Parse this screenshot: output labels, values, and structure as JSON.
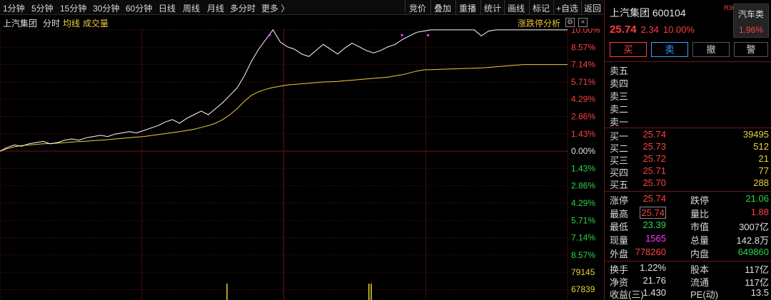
{
  "toolbar": {
    "periods": [
      "1分钟",
      "5分钟",
      "15分钟",
      "30分钟",
      "60分钟",
      "日线",
      "周线",
      "月线",
      "多分时",
      "更多 〉"
    ],
    "actions": [
      "竞价",
      "叠加",
      "重播",
      "统计",
      "画线",
      "标记",
      "+自选",
      "返回"
    ]
  },
  "chart_header": {
    "name": "上汽集团",
    "mode": "分时",
    "avg_label": "均线",
    "vol_label": "成交量",
    "limit_btn": "涨跌停分析",
    "gear": "⚙",
    "close": "×"
  },
  "chart_data": {
    "type": "line",
    "price_axis": {
      "left": [
        "",
        "",
        "",
        "",
        "",
        "",
        "",
        "",
        "",
        "",
        "",
        "",
        "",
        "",
        ""
      ],
      "right_labels": [
        "10.00%",
        "8.57%",
        "7.14%",
        "5.71%",
        "4.29%",
        "2.86%",
        "1.43%",
        "0.00%",
        "1.43%",
        "2.86%",
        "4.29%",
        "5.71%",
        "7.14%",
        "8.57%"
      ],
      "right_colors": [
        "red",
        "red",
        "red",
        "red",
        "red",
        "red",
        "red",
        "white",
        "green",
        "green",
        "green",
        "green",
        "green",
        "green"
      ],
      "ylim_pct": [
        -10,
        10
      ]
    },
    "volume_axis": {
      "labels": [
        "79145",
        "67839"
      ]
    },
    "x_minutes": 240,
    "price_pct": [
      0,
      0.3,
      0.5,
      0.4,
      0.6,
      0.7,
      0.8,
      0.6,
      0.7,
      0.9,
      1.0,
      0.9,
      1.1,
      1.2,
      1.3,
      1.2,
      1.4,
      1.5,
      1.6,
      1.5,
      1.7,
      1.9,
      2.1,
      2.4,
      2.6,
      2.3,
      2.7,
      3.0,
      3.3,
      3.0,
      3.5,
      4.0,
      4.6,
      5.2,
      6.2,
      7.4,
      8.4,
      9.2,
      10.0,
      9.0,
      8.6,
      8.4,
      8.0,
      7.8,
      8.3,
      8.8,
      8.4,
      8.0,
      8.5,
      8.9,
      8.6,
      8.3,
      8.1,
      8.3,
      8.6,
      8.8,
      9.2,
      9.5,
      9.8,
      9.9,
      10.0,
      10.0,
      10.0,
      10.0,
      10.0,
      10.0,
      10.0,
      9.5,
      9.9,
      10.0,
      10.0,
      10.0,
      10.0,
      10.0,
      10.0,
      10.0,
      10.0,
      10.0,
      10.0,
      10.0
    ],
    "avg_pct": [
      0,
      0.2,
      0.35,
      0.45,
      0.5,
      0.55,
      0.6,
      0.62,
      0.65,
      0.7,
      0.75,
      0.78,
      0.82,
      0.86,
      0.9,
      0.94,
      1.0,
      1.05,
      1.1,
      1.15,
      1.2,
      1.28,
      1.36,
      1.44,
      1.52,
      1.6,
      1.7,
      1.8,
      1.95,
      2.1,
      2.3,
      2.6,
      3.0,
      3.5,
      4.1,
      4.6,
      4.9,
      5.1,
      5.25,
      5.35,
      5.45,
      5.5,
      5.55,
      5.6,
      5.65,
      5.7,
      5.72,
      5.75,
      5.8,
      5.85,
      5.9,
      5.95,
      6.0,
      6.05,
      6.1,
      6.2,
      6.3,
      6.45,
      6.6,
      6.7,
      6.72,
      6.74,
      6.76,
      6.78,
      6.8,
      6.82,
      6.84,
      6.86,
      6.9,
      6.95,
      7.0,
      7.05,
      7.1,
      7.14,
      7.14,
      7.14,
      7.14,
      7.14,
      7.14,
      7.14
    ],
    "volume": [
      0.3,
      0,
      0,
      0,
      0,
      0,
      0,
      0,
      0,
      0,
      0,
      0,
      0,
      0,
      0,
      0,
      0,
      0,
      0,
      0,
      0,
      0,
      0,
      0,
      0,
      0,
      0,
      0,
      0,
      0,
      0,
      0,
      0,
      0,
      0,
      0,
      0,
      0,
      0,
      0,
      0,
      0,
      0,
      0,
      0,
      0,
      0,
      0,
      0,
      0,
      0,
      0,
      0,
      0,
      0,
      0,
      0,
      0,
      0,
      0,
      0,
      0,
      0,
      0,
      0,
      0,
      0,
      0,
      0,
      0,
      0,
      0,
      0,
      0,
      0,
      0,
      0,
      0,
      0,
      0
    ],
    "volume_spikes_minute": [
      96,
      156,
      157
    ],
    "markers_minute": [
      114,
      170,
      181
    ],
    "colors": {
      "price": "#ffffff",
      "avg": "#e8d23c",
      "grid": "#5a0f0f",
      "volume": "#e8d23c",
      "marker": "#ff3cff"
    }
  },
  "panel": {
    "title": "上汽集团 600104",
    "tag": "R300",
    "sector_name": "汽车类",
    "sector_pct": "1.96%",
    "price": "25.74",
    "change": "2.34",
    "change_pct": "10.00%",
    "buttons": {
      "buy": "买",
      "sell": "卖",
      "cancel": "撤",
      "warn": "警"
    },
    "asks": [
      {
        "label": "卖五",
        "price": "",
        "vol": ""
      },
      {
        "label": "卖四",
        "price": "",
        "vol": ""
      },
      {
        "label": "卖三",
        "price": "",
        "vol": ""
      },
      {
        "label": "卖二",
        "price": "",
        "vol": ""
      },
      {
        "label": "卖一",
        "price": "",
        "vol": ""
      }
    ],
    "bids": [
      {
        "label": "买一",
        "price": "25.74",
        "vol": "39495"
      },
      {
        "label": "买二",
        "price": "25.73",
        "vol": "512"
      },
      {
        "label": "买三",
        "price": "25.72",
        "vol": "21"
      },
      {
        "label": "买四",
        "price": "25.71",
        "vol": "77"
      },
      {
        "label": "买五",
        "price": "25.70",
        "vol": "288"
      }
    ],
    "stats": {
      "limit_up_l": "涨停",
      "limit_up_v": "25.74",
      "limit_down_l": "跌停",
      "limit_down_v": "21.06",
      "high_l": "最高",
      "high_v": "25.74",
      "vol_ratio_l": "量比",
      "vol_ratio_v": "1.88",
      "low_l": "最低",
      "low_v": "23.39",
      "mktcap_l": "市值",
      "mktcap_v": "3007亿",
      "last_vol_l": "现量",
      "last_vol_v": "1565",
      "total_vol_l": "总量",
      "total_vol_v": "142.8万",
      "outer_l": "外盘",
      "outer_v": "778260",
      "inner_l": "内盘",
      "inner_v": "649860"
    },
    "fund": {
      "turnover_l": "换手",
      "turnover_v": "1.22%",
      "shares_l": "股本",
      "shares_v": "117亿",
      "nav_l": "净资",
      "nav_v": "21.76",
      "float_l": "流通",
      "float_v": "117亿",
      "eps_l": "收益(三)",
      "eps_v": "1.430",
      "pe_l": "PE(动)",
      "pe_v": "13.5"
    }
  }
}
